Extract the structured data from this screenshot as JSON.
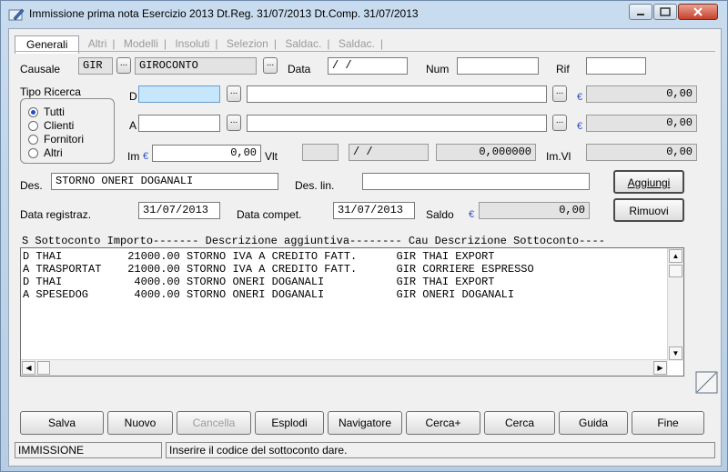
{
  "window": {
    "title": "Immissione prima nota  Esercizio 2013  Dt.Reg. 31/07/2013  Dt.Comp. 31/07/2013"
  },
  "tabs": [
    "Generali",
    "Altri",
    "Modelli",
    "Insoluti",
    "Selezion",
    "Saldac.",
    "Saldac."
  ],
  "form": {
    "causale_label": "Causale",
    "causale_code": "GIR",
    "causale_desc": "GIROCONTO",
    "data_label": "Data",
    "data_value": " /  /",
    "num_label": "Num",
    "num_value": "",
    "rif_label": "Rif",
    "rif_value": "",
    "tipo_ricerca_label": "Tipo Ricerca",
    "radio_options": [
      "Tutti",
      "Clienti",
      "Fornitori",
      "Altri"
    ],
    "radio_selected": "Tutti",
    "d_label": "D",
    "d_code": "",
    "d_desc": "",
    "d_amount": "0,00",
    "a_label": "A",
    "a_code": "",
    "a_desc": "",
    "a_amount": "0,00",
    "im_label": "Im",
    "im_value": "0,00",
    "vlt_label": "Vlt",
    "vlt_value": "",
    "vlt_date": " /  /",
    "vlt_rate": "0,000000",
    "imvl_label": "Im.Vl",
    "imvl_value": "0,00",
    "des_label": "Des.",
    "des_value": "STORNO ONERI DOGANALI",
    "deslin_label": "Des. lin.",
    "deslin_value": "",
    "data_registraz_label": "Data registraz.",
    "data_registraz_value": "31/07/2013",
    "data_compet_label": "Data compet.",
    "data_compet_value": "31/07/2013",
    "saldo_label": "Saldo",
    "saldo_value": "0,00",
    "euro_symbol": "€",
    "dots_symbol": "..."
  },
  "side_buttons": {
    "aggiungi": "Aggiungi",
    "rimuovi": "Rimuovi"
  },
  "list": {
    "header": "S Sottoconto Importo------- Descrizione aggiuntiva-------- Cau Descrizione Sottoconto----",
    "rows": [
      "D THAI          21000.00 STORNO IVA A CREDITO FATT.      GIR THAI EXPORT",
      "A TRASPORTAT    21000.00 STORNO IVA A CREDITO FATT.      GIR CORRIERE ESPRESSO",
      "D THAI           4000.00 STORNO ONERI DOGANALI           GIR THAI EXPORT",
      "A SPESEDOG       4000.00 STORNO ONERI DOGANALI           GIR ONERI DOGANALI"
    ]
  },
  "bottom_buttons": [
    "Salva",
    "Nuovo",
    "Cancella",
    "Esplodi",
    "Navigatore",
    "Cerca+",
    "Cerca",
    "Guida",
    "Fine"
  ],
  "status": {
    "mode": "IMMISSIONE",
    "message": "Inserire il codice del sottoconto dare."
  },
  "colors": {
    "active_field": "#c6e6fb",
    "euro_blue": "#2b4fc4",
    "frame": "#b6cde4"
  }
}
